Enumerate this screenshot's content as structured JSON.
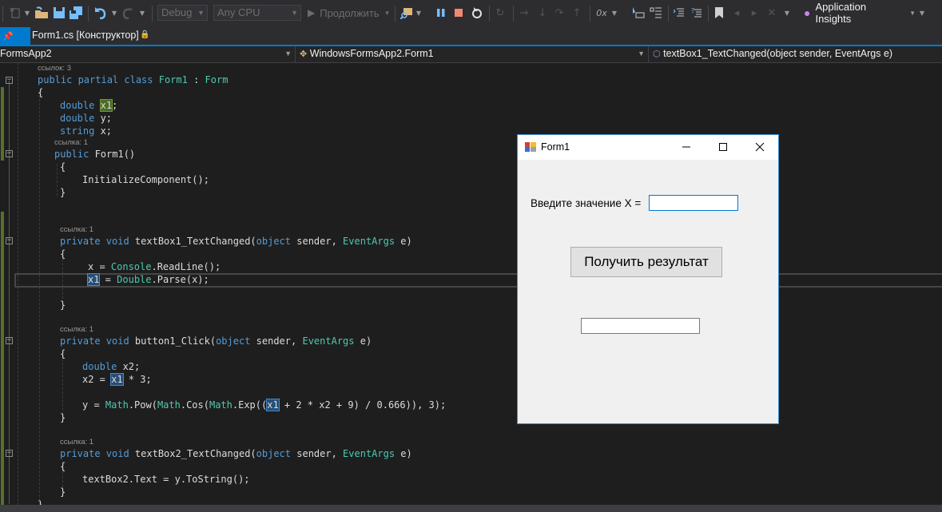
{
  "toolbar": {
    "config": "Debug",
    "platform": "Any CPU",
    "continue_label": "Продолжить",
    "app_insights_label": "Application Insights",
    "icons": [
      "new-project-icon",
      "open-folder-icon",
      "save-icon",
      "save-all-icon",
      "undo-icon",
      "redo-icon",
      "continue-play-icon",
      "find-in-files-icon",
      "pause-icon",
      "stop-icon",
      "restart-icon",
      "refresh-icon",
      "step-arrow-icon",
      "step-into-icon",
      "step-over-icon",
      "step-out-icon",
      "hex-display-icon",
      "select-element-icon",
      "outline-icon",
      "indent-icon",
      "comment-icon",
      "bookmark-icon",
      "prev-bookmark-icon",
      "next-bookmark-icon",
      "clear-bookmark-icon",
      "lightbulb-icon"
    ]
  },
  "tab": {
    "title": "Form1.cs [Конструктор]"
  },
  "navbar": {
    "project": "FormsApp2",
    "class": "WindowsFormsApp2.Form1",
    "member": "textBox1_TextChanged(object sender, EventArgs e)"
  },
  "code": {
    "lens_class": "ссылок: 3",
    "lens_ctor": "ссылка: 1",
    "lens_tb1": "ссылка: 1",
    "lens_btn": "ссылка: 1",
    "lens_tb2": "ссылка: 1"
  },
  "form": {
    "title": "Form1",
    "label": "Введите значение X =",
    "input_value": "",
    "button_label": "Получить результат",
    "result_value": ""
  },
  "colors": {
    "accent": "#007acc",
    "keyword": "#569cd6",
    "type": "#4ec9b0",
    "editor_bg": "#1e1e1e"
  }
}
